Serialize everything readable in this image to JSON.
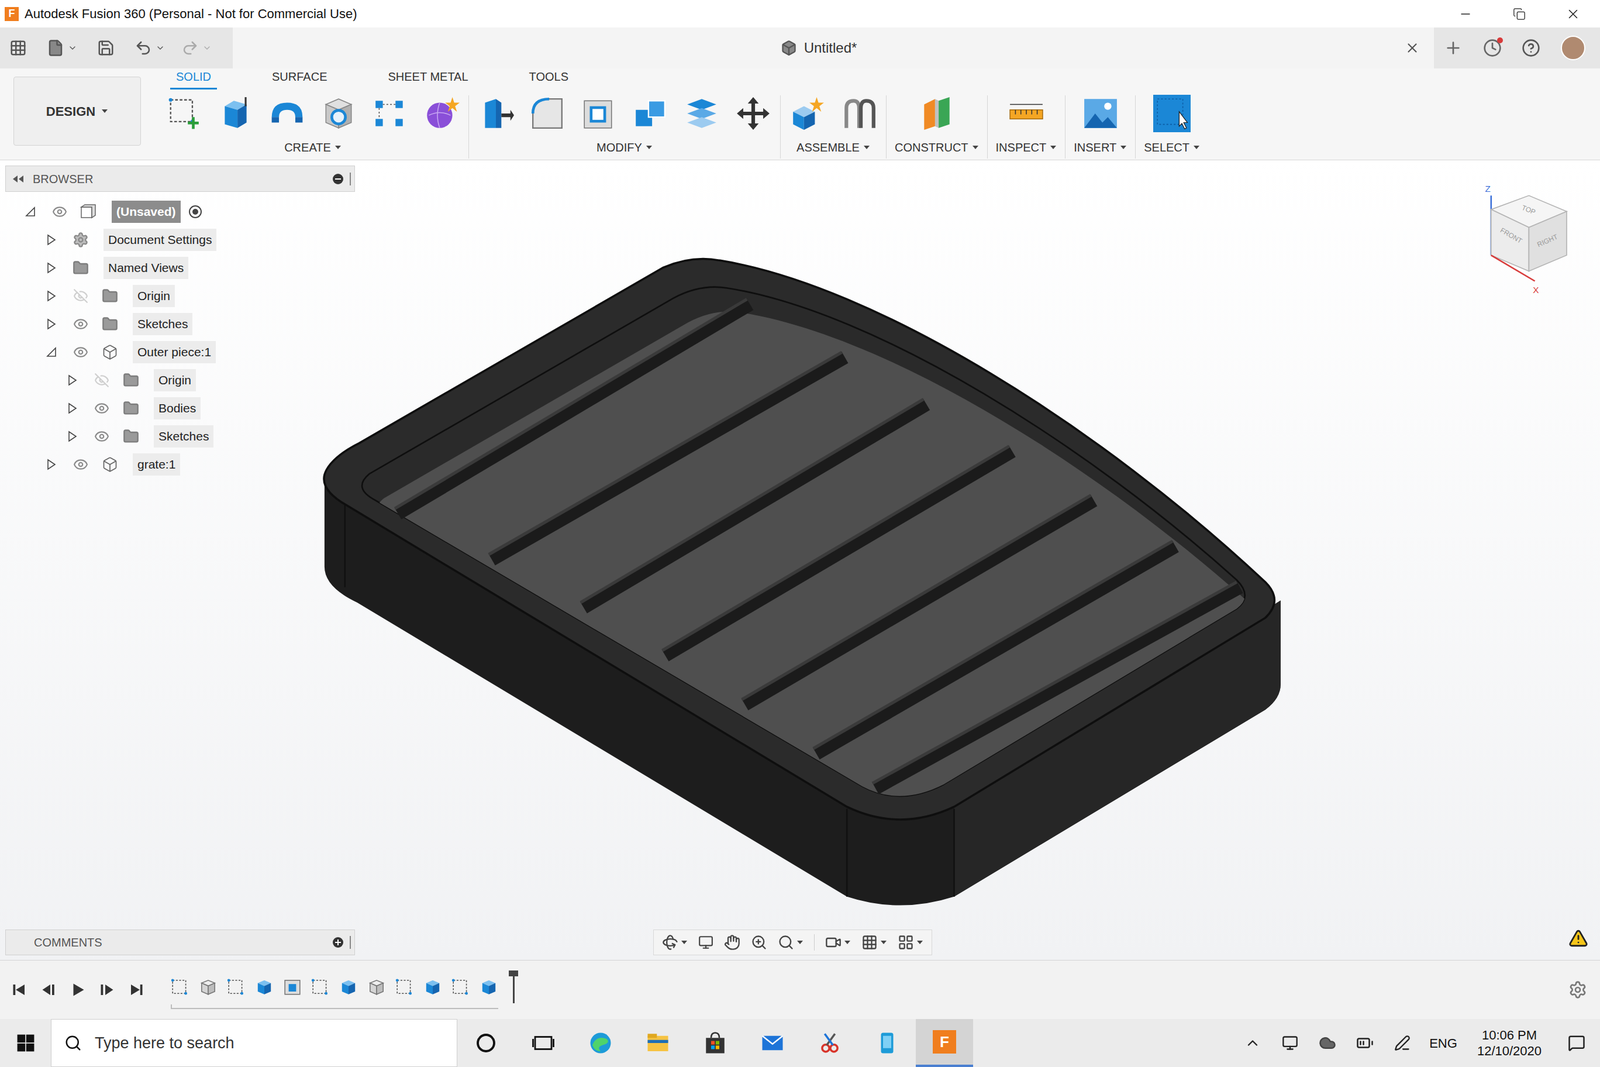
{
  "window": {
    "title": "Autodesk Fusion 360 (Personal - Not for Commercial Use)",
    "logo": "F"
  },
  "document_tab": {
    "title": "Untitled*"
  },
  "workspace": {
    "label": "DESIGN"
  },
  "toolbar_tabs": [
    {
      "label": "SOLID",
      "selected": true
    },
    {
      "label": "SURFACE",
      "selected": false
    },
    {
      "label": "SHEET METAL",
      "selected": false
    },
    {
      "label": "TOOLS",
      "selected": false
    }
  ],
  "tool_groups": [
    {
      "label": "CREATE",
      "tools": [
        {
          "kind": "sketch",
          "selected": false
        },
        {
          "kind": "extrude",
          "selected": false
        },
        {
          "kind": "revolve",
          "selected": false
        },
        {
          "kind": "hole",
          "selected": false
        },
        {
          "kind": "pattern",
          "selected": false
        },
        {
          "kind": "form",
          "selected": false
        }
      ]
    },
    {
      "label": "MODIFY",
      "tools": [
        {
          "kind": "press-pull",
          "selected": false
        },
        {
          "kind": "fillet",
          "selected": false
        },
        {
          "kind": "shell",
          "selected": false
        },
        {
          "kind": "combine",
          "selected": false
        },
        {
          "kind": "offset",
          "selected": false
        },
        {
          "kind": "move",
          "selected": false
        }
      ]
    },
    {
      "label": "ASSEMBLE",
      "tools": [
        {
          "kind": "component",
          "selected": false
        },
        {
          "kind": "joint",
          "selected": false
        }
      ]
    },
    {
      "label": "CONSTRUCT",
      "tools": [
        {
          "kind": "plane",
          "selected": false
        }
      ]
    },
    {
      "label": "INSPECT",
      "tools": [
        {
          "kind": "measure",
          "selected": false
        }
      ]
    },
    {
      "label": "INSERT",
      "tools": [
        {
          "kind": "image",
          "selected": false
        }
      ]
    },
    {
      "label": "SELECT",
      "tools": [
        {
          "kind": "select",
          "selected": true
        }
      ]
    }
  ],
  "browser": {
    "title": "BROWSER",
    "items": [
      {
        "label": "(Unsaved)",
        "depth": 0,
        "kind": "root",
        "expanded": true,
        "visible": true
      },
      {
        "label": "Document Settings",
        "depth": 1,
        "kind": "settings",
        "expanded": false
      },
      {
        "label": "Named Views",
        "depth": 1,
        "kind": "views",
        "expanded": false
      },
      {
        "label": "Origin",
        "depth": 1,
        "kind": "folder",
        "expanded": false,
        "visible": false
      },
      {
        "label": "Sketches",
        "depth": 1,
        "kind": "folder",
        "expanded": false,
        "visible": true
      },
      {
        "label": "Outer piece:1",
        "depth": 1,
        "kind": "component",
        "expanded": true,
        "visible": true
      },
      {
        "label": "Origin",
        "depth": 2,
        "kind": "folder",
        "expanded": false,
        "visible": false
      },
      {
        "label": "Bodies",
        "depth": 2,
        "kind": "folder",
        "expanded": false,
        "visible": true
      },
      {
        "label": "Sketches",
        "depth": 2,
        "kind": "folder",
        "expanded": false,
        "visible": true
      },
      {
        "label": "grate:1",
        "depth": 1,
        "kind": "component",
        "expanded": false,
        "visible": true
      }
    ]
  },
  "comments": {
    "title": "COMMENTS"
  },
  "view_cube": {
    "top": "TOP",
    "front": "FRONT",
    "right": "RIGHT",
    "axis_z": "Z",
    "axis_x": "X"
  },
  "timeline": {
    "features": [
      {
        "kind": "sketch"
      },
      {
        "kind": "body"
      },
      {
        "kind": "sketch"
      },
      {
        "kind": "extrude"
      },
      {
        "kind": "shell"
      },
      {
        "kind": "sketch"
      },
      {
        "kind": "extrude"
      },
      {
        "kind": "body"
      },
      {
        "kind": "sketch"
      },
      {
        "kind": "extrude"
      },
      {
        "kind": "sketch"
      },
      {
        "kind": "extrude"
      }
    ]
  },
  "taskbar": {
    "search_placeholder": "Type here to search",
    "apps": [
      {
        "kind": "cortana",
        "selected": false
      },
      {
        "kind": "task-view",
        "selected": false
      },
      {
        "kind": "edge",
        "selected": false
      },
      {
        "kind": "explorer",
        "selected": false
      },
      {
        "kind": "store",
        "selected": false
      },
      {
        "kind": "mail",
        "selected": false
      },
      {
        "kind": "snip",
        "selected": false
      },
      {
        "kind": "files",
        "selected": false
      },
      {
        "kind": "fusion",
        "selected": true
      }
    ],
    "language": "ENG",
    "time": "10:06 PM",
    "date": "12/10/2020"
  }
}
